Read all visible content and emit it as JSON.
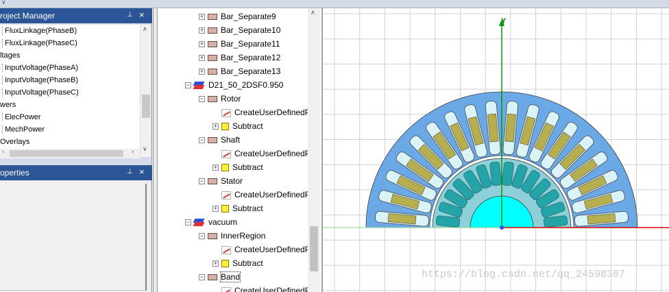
{
  "project_manager": {
    "title": "roject Manager",
    "pin_glyph": "⊥",
    "close_glyph": "×",
    "rows": [
      {
        "label": "FluxLinkage(PhaseB)",
        "indent": true
      },
      {
        "label": "FluxLinkage(PhaseC)",
        "indent": true
      },
      {
        "label": "ltages",
        "indent": false
      },
      {
        "label": "InputVoltage(PhaseA)",
        "indent": true
      },
      {
        "label": "InputVoltage(PhaseB)",
        "indent": true
      },
      {
        "label": "InputVoltage(PhaseC)",
        "indent": true
      },
      {
        "label": "wers",
        "indent": false
      },
      {
        "label": "ElecPower",
        "indent": true
      },
      {
        "label": "MechPower",
        "indent": true
      },
      {
        "label": "Overlays",
        "indent": false
      }
    ]
  },
  "properties": {
    "title": "operties",
    "pin_glyph": "⊥",
    "close_glyph": "×"
  },
  "tree": {
    "rows": [
      {
        "label": "Bar_Separate9",
        "level": 1,
        "exp": "+",
        "icon": "box"
      },
      {
        "label": "Bar_Separate10",
        "level": 1,
        "exp": "+",
        "icon": "box"
      },
      {
        "label": "Bar_Separate11",
        "level": 1,
        "exp": "+",
        "icon": "box"
      },
      {
        "label": "Bar_Separate12",
        "level": 1,
        "exp": "+",
        "icon": "box"
      },
      {
        "label": "Bar_Separate13",
        "level": 1,
        "exp": "+",
        "icon": "box"
      },
      {
        "label": "D21_50_2DSF0.950",
        "level": 0,
        "exp": "−",
        "icon": "solid"
      },
      {
        "label": "Rotor",
        "level": 1,
        "exp": "−",
        "icon": "box"
      },
      {
        "label": "CreateUserDefinedPart",
        "level": 2,
        "exp": "",
        "icon": "script"
      },
      {
        "label": "Subtract",
        "level": 2,
        "exp": "+",
        "icon": "yellow"
      },
      {
        "label": "Shaft",
        "level": 1,
        "exp": "−",
        "icon": "box"
      },
      {
        "label": "CreateUserDefinedPart",
        "level": 2,
        "exp": "",
        "icon": "script"
      },
      {
        "label": "Subtract",
        "level": 2,
        "exp": "+",
        "icon": "yellow"
      },
      {
        "label": "Stator",
        "level": 1,
        "exp": "−",
        "icon": "box"
      },
      {
        "label": "CreateUserDefinedPart",
        "level": 2,
        "exp": "",
        "icon": "script"
      },
      {
        "label": "Subtract",
        "level": 2,
        "exp": "+",
        "icon": "yellow"
      },
      {
        "label": "vacuum",
        "level": 0,
        "exp": "−",
        "icon": "solid"
      },
      {
        "label": "InnerRegion",
        "level": 1,
        "exp": "−",
        "icon": "box"
      },
      {
        "label": "CreateUserDefinedPart",
        "level": 2,
        "exp": "",
        "icon": "script"
      },
      {
        "label": "Subtract",
        "level": 2,
        "exp": "+",
        "icon": "yellow"
      },
      {
        "label": "Band",
        "level": 1,
        "exp": "−",
        "icon": "box",
        "selected": true
      },
      {
        "label": "CreateUserDefinedPart",
        "level": 2,
        "exp": "",
        "icon": "script"
      }
    ]
  },
  "viewport": {
    "y_axis_label": "Y",
    "watermark": "https://blog.csdn.net/qq_24598387",
    "colors": {
      "stator": "#6aa8e6",
      "stator_slot": "#d9f3f6",
      "coil": "#b7ae4e",
      "rotor": "#8ed0d9",
      "rotor_slot": "#24a3a8",
      "shaft": "#00ffff",
      "grid": "#d0d0d0",
      "y_axis": "#009a00",
      "x_axis": "#e00000"
    },
    "stator_slot_count": 36,
    "rotor_slot_count": 28
  }
}
